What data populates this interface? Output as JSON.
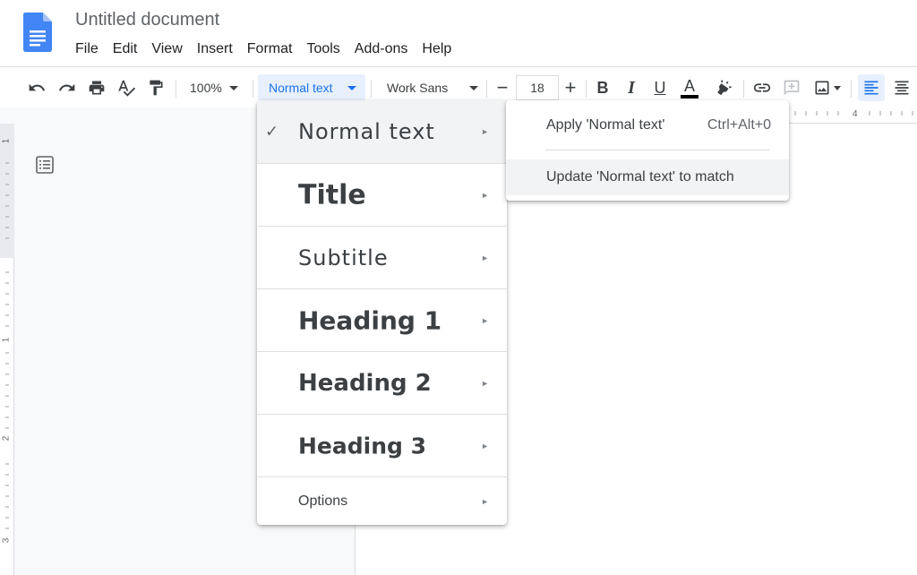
{
  "app": {
    "doc_title": "Untitled document",
    "logo_icon": "google-docs-icon",
    "accent": "#1a73e8"
  },
  "menubar": [
    "File",
    "Edit",
    "View",
    "Insert",
    "Format",
    "Tools",
    "Add-ons",
    "Help"
  ],
  "toolbar": {
    "zoom": "100%",
    "paragraph_style": "Normal text",
    "font": "Work Sans",
    "font_size": "18",
    "minus": "−",
    "plus": "+",
    "bold": "B",
    "italic": "I",
    "underline": "U",
    "text_color": "A",
    "icons": [
      "undo-icon",
      "redo-icon",
      "print-icon",
      "spellcheck-icon",
      "paint-format-icon",
      "highlight-icon",
      "link-icon",
      "add-comment-icon",
      "insert-image-icon",
      "align-left-icon",
      "align-center-icon"
    ]
  },
  "ruler": {
    "h_number": "4",
    "v_numbers": [
      "1",
      "1",
      "2",
      "3"
    ]
  },
  "style_menu": {
    "items": [
      {
        "label": "Normal text",
        "checked": true
      },
      {
        "label": "Title"
      },
      {
        "label": "Subtitle"
      },
      {
        "label": "Heading 1"
      },
      {
        "label": "Heading 2"
      },
      {
        "label": "Heading 3"
      },
      {
        "label": "Options"
      }
    ],
    "arrow": "►",
    "check": "✓"
  },
  "submenu": {
    "apply_label": "Apply 'Normal text'",
    "apply_shortcut": "Ctrl+Alt+0",
    "update_label": "Update 'Normal text' to match"
  }
}
